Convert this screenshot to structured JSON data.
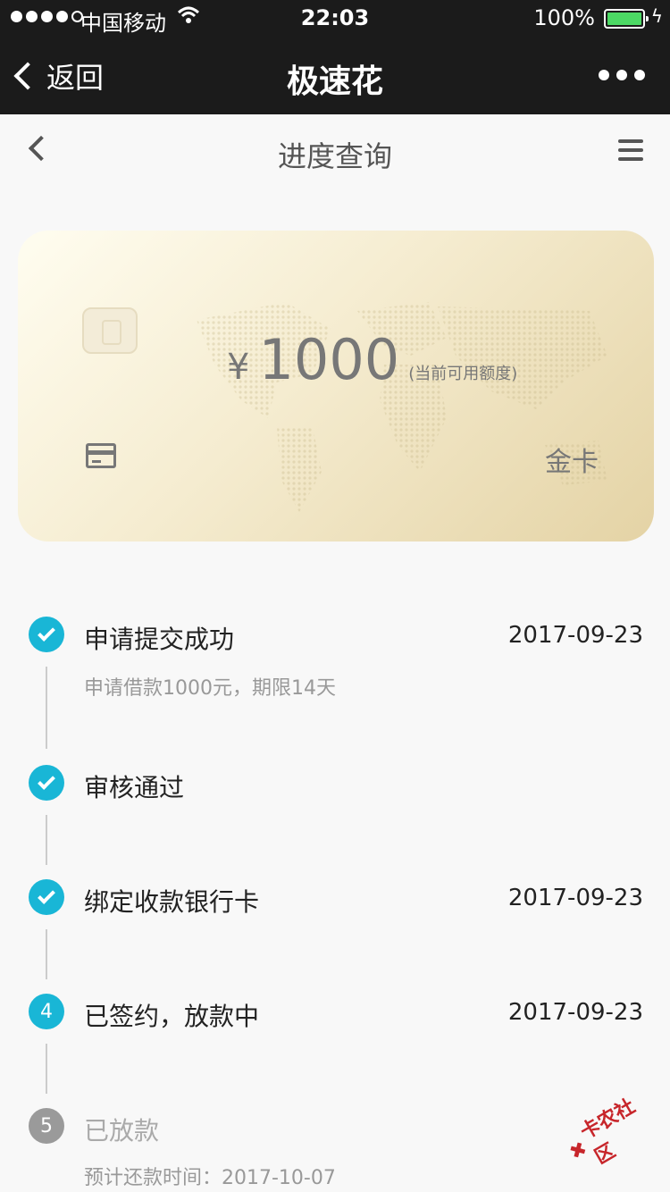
{
  "status_bar": {
    "carrier": "中国移动",
    "time": "22:03",
    "battery": "100%",
    "battery_level": 1.0
  },
  "nav": {
    "back_label": "返回",
    "title": "极速花"
  },
  "subheader": {
    "title": "进度查询"
  },
  "card": {
    "currency": "¥",
    "amount": "1000",
    "amount_note": "(当前可用额度)",
    "tier": "金卡"
  },
  "steps": [
    {
      "marker": "",
      "title": "申请提交成功",
      "date": "2017-09-23",
      "note": "申请借款1000元，期限14天",
      "state": "done"
    },
    {
      "marker": "",
      "title": "审核通过",
      "date": "",
      "note": "",
      "state": "done"
    },
    {
      "marker": "",
      "title": "绑定收款银行卡",
      "date": "2017-09-23",
      "note": "",
      "state": "done"
    },
    {
      "marker": "4",
      "title": "已签约，放款中",
      "date": "2017-09-23",
      "note": "",
      "state": "current"
    },
    {
      "marker": "5",
      "title": "已放款",
      "date": "",
      "note": "预计还款时间：2017-10-07",
      "state": "pending"
    }
  ],
  "watermark": "卡农社区",
  "colors": {
    "accent": "#19b6d6",
    "pending": "#9a9a9a",
    "header_bg": "#1b1b1b",
    "battery": "#4cd964"
  }
}
